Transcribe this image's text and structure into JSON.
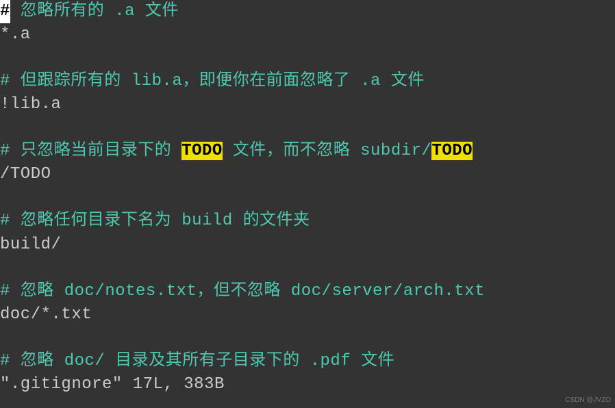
{
  "cursor_char": "#",
  "line1_rest": " 忽略所有的 .a 文件",
  "line2": "*.a",
  "line4": "# 但跟踪所有的 lib.a，即便你在前面忽略了 .a 文件",
  "line5": "!lib.a",
  "line7_a": "# 只忽略当前目录下的 ",
  "line7_hl1": "TODO",
  "line7_b": " 文件，而不忽略 subdir/",
  "line7_hl2": "TODO",
  "line8": "/TODO",
  "line10": "# 忽略任何目录下名为 build 的文件夹",
  "line11": "build/",
  "line13": "# 忽略 doc/notes.txt，但不忽略 doc/server/arch.txt",
  "line14": "doc/*.txt",
  "line16": "# 忽略 doc/ 目录及其所有子目录下的 .pdf 文件",
  "status_line": "\".gitignore\" 17L, 383B",
  "watermark": "CSDN @JVZO"
}
